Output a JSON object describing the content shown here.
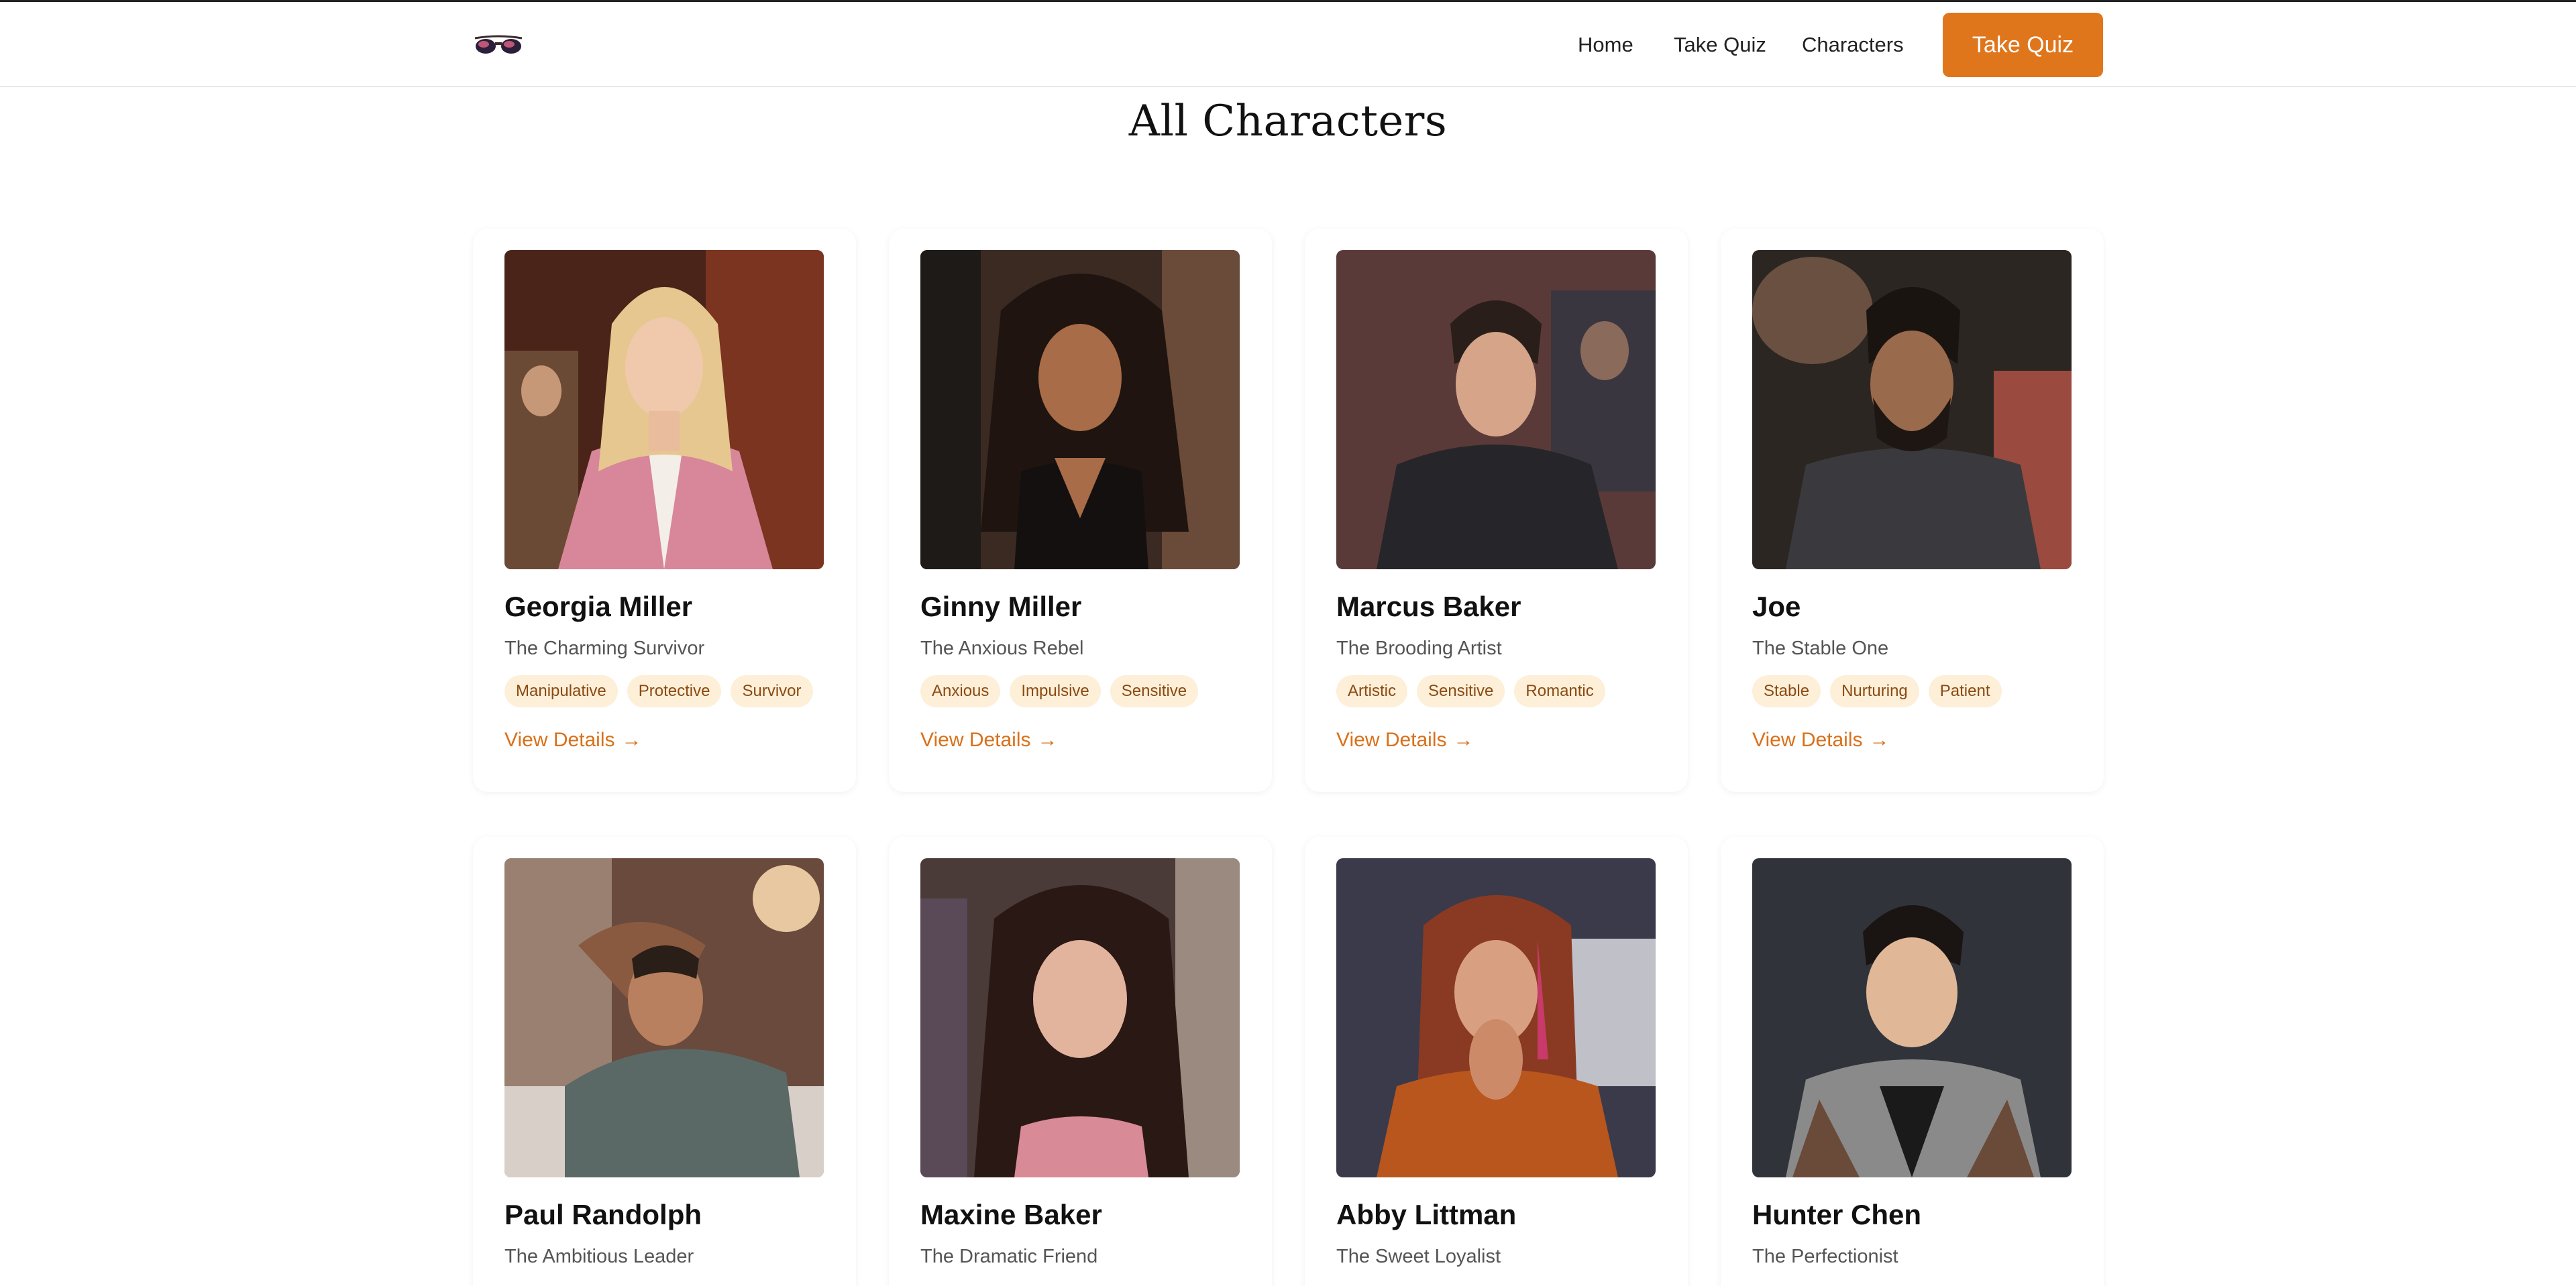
{
  "nav": {
    "logo_icon": "sunglasses-icon",
    "links": [
      {
        "label": "Home"
      },
      {
        "label": "Take Quiz"
      },
      {
        "label": "Characters"
      }
    ],
    "cta_label": "Take Quiz",
    "accent_color": "#e0761c"
  },
  "page": {
    "title": "All Characters"
  },
  "characters": [
    {
      "name": "Georgia Miller",
      "role": "The Charming Survivor",
      "tags": [
        "Manipulative",
        "Protective",
        "Survivor"
      ],
      "details_label": "View Details",
      "arrow_icon": "arrow-right-icon"
    },
    {
      "name": "Ginny Miller",
      "role": "The Anxious Rebel",
      "tags": [
        "Anxious",
        "Impulsive",
        "Sensitive"
      ],
      "details_label": "View Details",
      "arrow_icon": "arrow-right-icon"
    },
    {
      "name": "Marcus Baker",
      "role": "The Brooding Artist",
      "tags": [
        "Artistic",
        "Sensitive",
        "Romantic"
      ],
      "details_label": "View Details",
      "arrow_icon": "arrow-right-icon"
    },
    {
      "name": "Joe",
      "role": "The Stable One",
      "tags": [
        "Stable",
        "Nurturing",
        "Patient"
      ],
      "details_label": "View Details",
      "arrow_icon": "arrow-right-icon"
    },
    {
      "name": "Paul Randolph",
      "role": "The Ambitious Leader"
    },
    {
      "name": "Maxine Baker",
      "role": "The Dramatic Friend"
    },
    {
      "name": "Abby Littman",
      "role": "The Sweet Loyalist"
    },
    {
      "name": "Hunter Chen",
      "role": "The Perfectionist"
    }
  ]
}
